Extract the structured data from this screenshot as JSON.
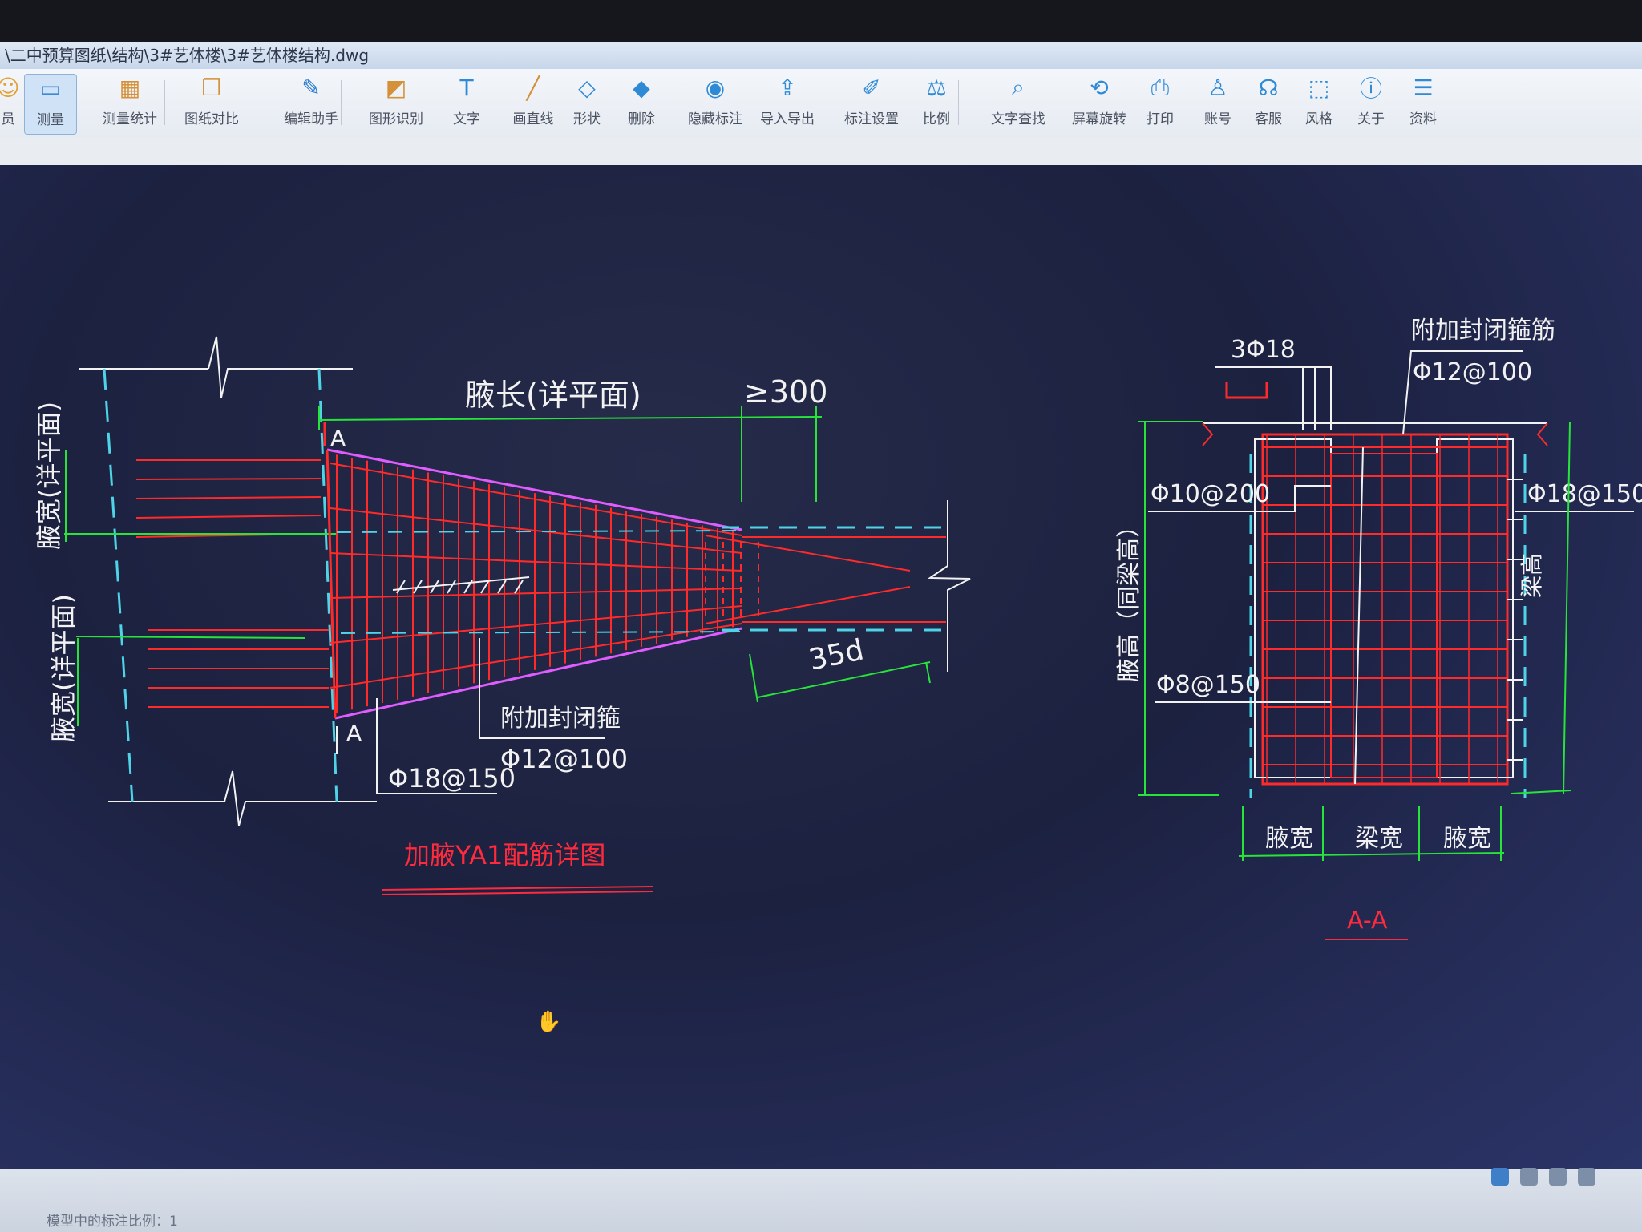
{
  "window": {
    "title": "\\二中预算图纸\\结构\\3#艺体楼\\3#艺体楼结构.dwg"
  },
  "toolbar": {
    "items": [
      {
        "label": "员",
        "icon": "user-badge-icon"
      },
      {
        "label": "测量",
        "icon": "ruler-icon"
      },
      {
        "label": "测量统计",
        "icon": "measure-stats-icon"
      },
      {
        "label": "图纸对比",
        "icon": "compare-icon"
      },
      {
        "label": "编辑助手",
        "icon": "edit-assistant-icon"
      },
      {
        "label": "图形识别",
        "icon": "shape-recognize-icon"
      },
      {
        "label": "文字",
        "icon": "text-icon"
      },
      {
        "label": "画直线",
        "icon": "line-icon"
      },
      {
        "label": "形状",
        "icon": "shape-icon"
      },
      {
        "label": "删除",
        "icon": "eraser-icon"
      },
      {
        "label": "隐藏标注",
        "icon": "hide-eye-icon"
      },
      {
        "label": "导入导出",
        "icon": "import-export-icon"
      },
      {
        "label": "标注设置",
        "icon": "annotation-settings-icon"
      },
      {
        "label": "比例",
        "icon": "scale-icon"
      },
      {
        "label": "文字查找",
        "icon": "text-search-icon"
      },
      {
        "label": "屏幕旋转",
        "icon": "rotate-screen-icon"
      },
      {
        "label": "打印",
        "icon": "printer-icon"
      },
      {
        "label": "账号",
        "icon": "account-icon"
      },
      {
        "label": "客服",
        "icon": "headset-icon"
      },
      {
        "label": "风格",
        "icon": "style-icon"
      },
      {
        "label": "关于",
        "icon": "info-icon"
      },
      {
        "label": "资料",
        "icon": "docs-icon"
      }
    ],
    "active": "测量"
  },
  "drawing": {
    "colors": {
      "rebar": "#ff2a2a",
      "dimension": "#27e33a",
      "outline": "#f2f2f2",
      "centerline": "#4fd3e6",
      "haunch_edge": "#e05cff",
      "yellow_tick": "#e8e03a",
      "title_red": "#ff2b3c"
    },
    "detail": {
      "haunch_length": "腋长(详平面)",
      "min_300": "≥300",
      "haunch_width_top": "腋宽(详平面)",
      "haunch_width_bottom": "腋宽(详平面)",
      "section_mark_top": "A",
      "section_mark_bottom": "A",
      "anchor_35d": "35d",
      "extra_stirrup": "附加封闭箍",
      "stirrup_spec": "Φ12@100",
      "rebar_spec": "Φ18@150",
      "title": "加腋YA1配筋详图"
    },
    "section": {
      "top_bars": "3Φ18",
      "extra_stirrup": "附加封闭箍筋",
      "extra_stirrup_spec": "Φ12@100",
      "spec_left_top": "Φ10@200",
      "spec_right": "Φ18@150",
      "spec_left_bottom": "Φ8@150",
      "height_label": "腋高（同梁高）",
      "beam_height": "梁高",
      "width_labels": [
        "腋宽",
        "梁宽",
        "腋宽"
      ],
      "title": "A-A"
    }
  },
  "status": {
    "text": "模型中的标注比例：1"
  }
}
